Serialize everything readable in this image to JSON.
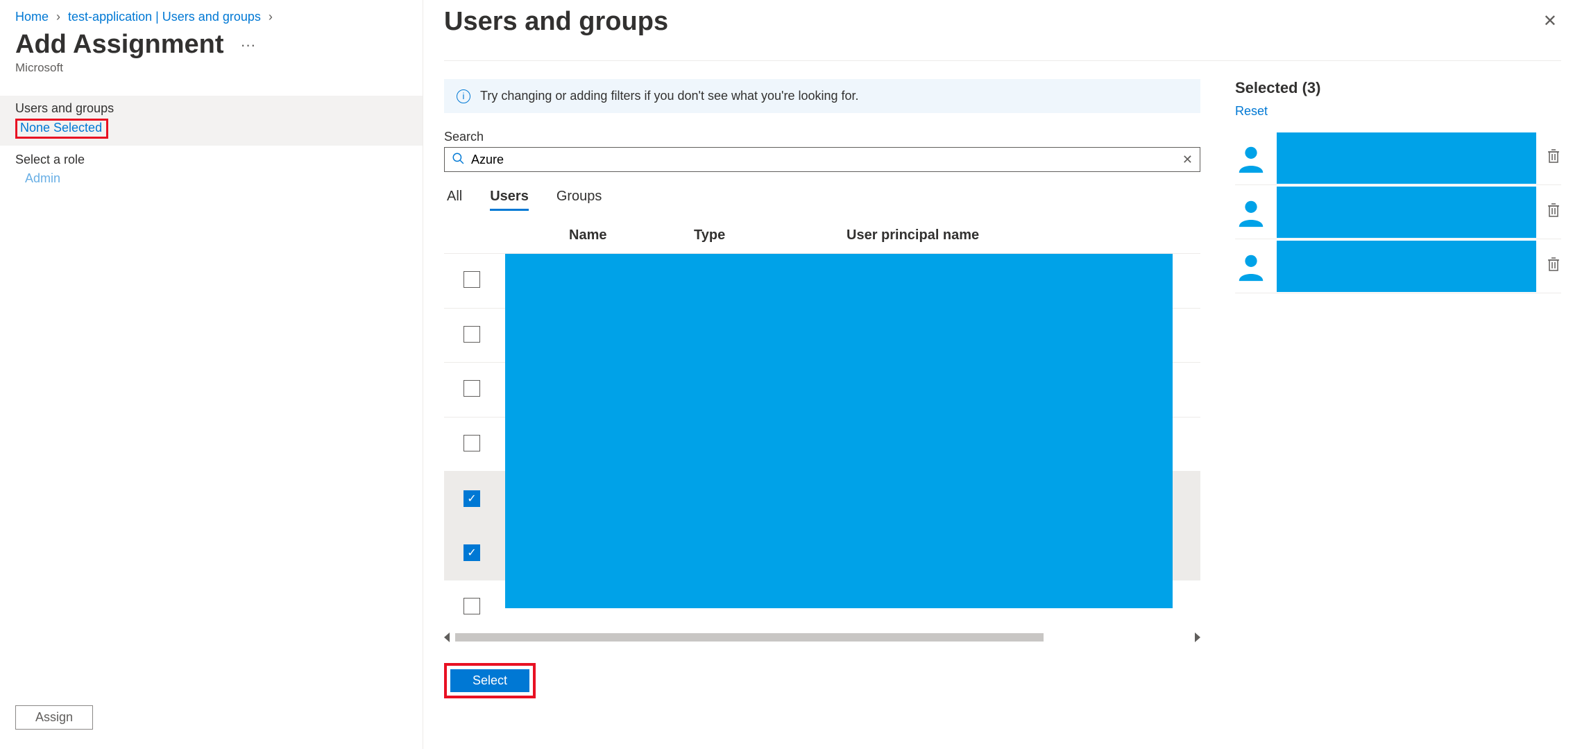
{
  "breadcrumb": {
    "home": "Home",
    "app": "test-application | Users and groups"
  },
  "page": {
    "title": "Add Assignment",
    "org": "Microsoft"
  },
  "left_panel": {
    "users_groups_label": "Users and groups",
    "none_selected": "None Selected",
    "select_role_label": "Select a role",
    "role_value": "Admin",
    "assign_btn": "Assign"
  },
  "panel": {
    "title": "Users and groups",
    "info": "Try changing or adding filters if you don't see what you're looking for.",
    "search_label": "Search",
    "search_value": "Azure",
    "tabs": {
      "all": "All",
      "users": "Users",
      "groups": "Groups"
    },
    "columns": {
      "name": "Name",
      "type": "Type",
      "upn": "User principal name"
    },
    "rows": [
      {
        "checked": false
      },
      {
        "checked": false
      },
      {
        "checked": false
      },
      {
        "checked": false
      },
      {
        "checked": true
      },
      {
        "checked": true
      },
      {
        "checked": false
      }
    ],
    "select_btn": "Select"
  },
  "selected": {
    "title": "Selected (3)",
    "reset": "Reset",
    "count": 3
  }
}
